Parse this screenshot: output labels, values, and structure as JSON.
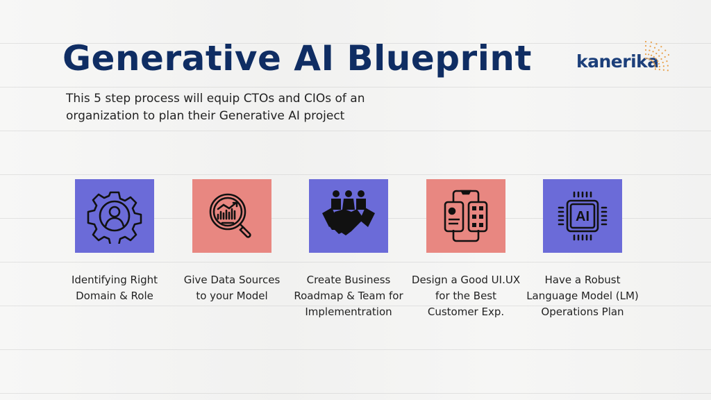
{
  "header": {
    "title": "Generative AI Blueprint",
    "subtitle": "This 5 step process will equip CTOs and CIOs of an organization to plan their Generative AI project"
  },
  "logo": {
    "text": "kanerika",
    "text_color": "#1c3f7a",
    "accent_color": "#e8a04a"
  },
  "colors": {
    "title": "#0f2d63",
    "tile_blue": "#6b6bd8",
    "tile_red": "#e88781"
  },
  "steps": [
    {
      "icon": "gear-person-icon",
      "tile_color": "#6b6bd8",
      "label_line1": "Identifying Right",
      "label_line2": "Domain & Role",
      "label_line3": ""
    },
    {
      "icon": "magnifier-chart-icon",
      "tile_color": "#e88781",
      "label_line1": "Give Data Sources",
      "label_line2": "to your Model",
      "label_line3": ""
    },
    {
      "icon": "team-handshake-icon",
      "tile_color": "#6b6bd8",
      "label_line1": "Create Business",
      "label_line2": "Roadmap & Team for",
      "label_line3": "Implementration"
    },
    {
      "icon": "mobile-ui-icon",
      "tile_color": "#e88781",
      "label_line1": "Design a Good UI.UX",
      "label_line2": "for the Best",
      "label_line3": "Customer Exp."
    },
    {
      "icon": "ai-chip-icon",
      "tile_color": "#6b6bd8",
      "label_line1": "Have a Robust",
      "label_line2": "Language Model (LM)",
      "label_line3": "Operations Plan"
    }
  ]
}
